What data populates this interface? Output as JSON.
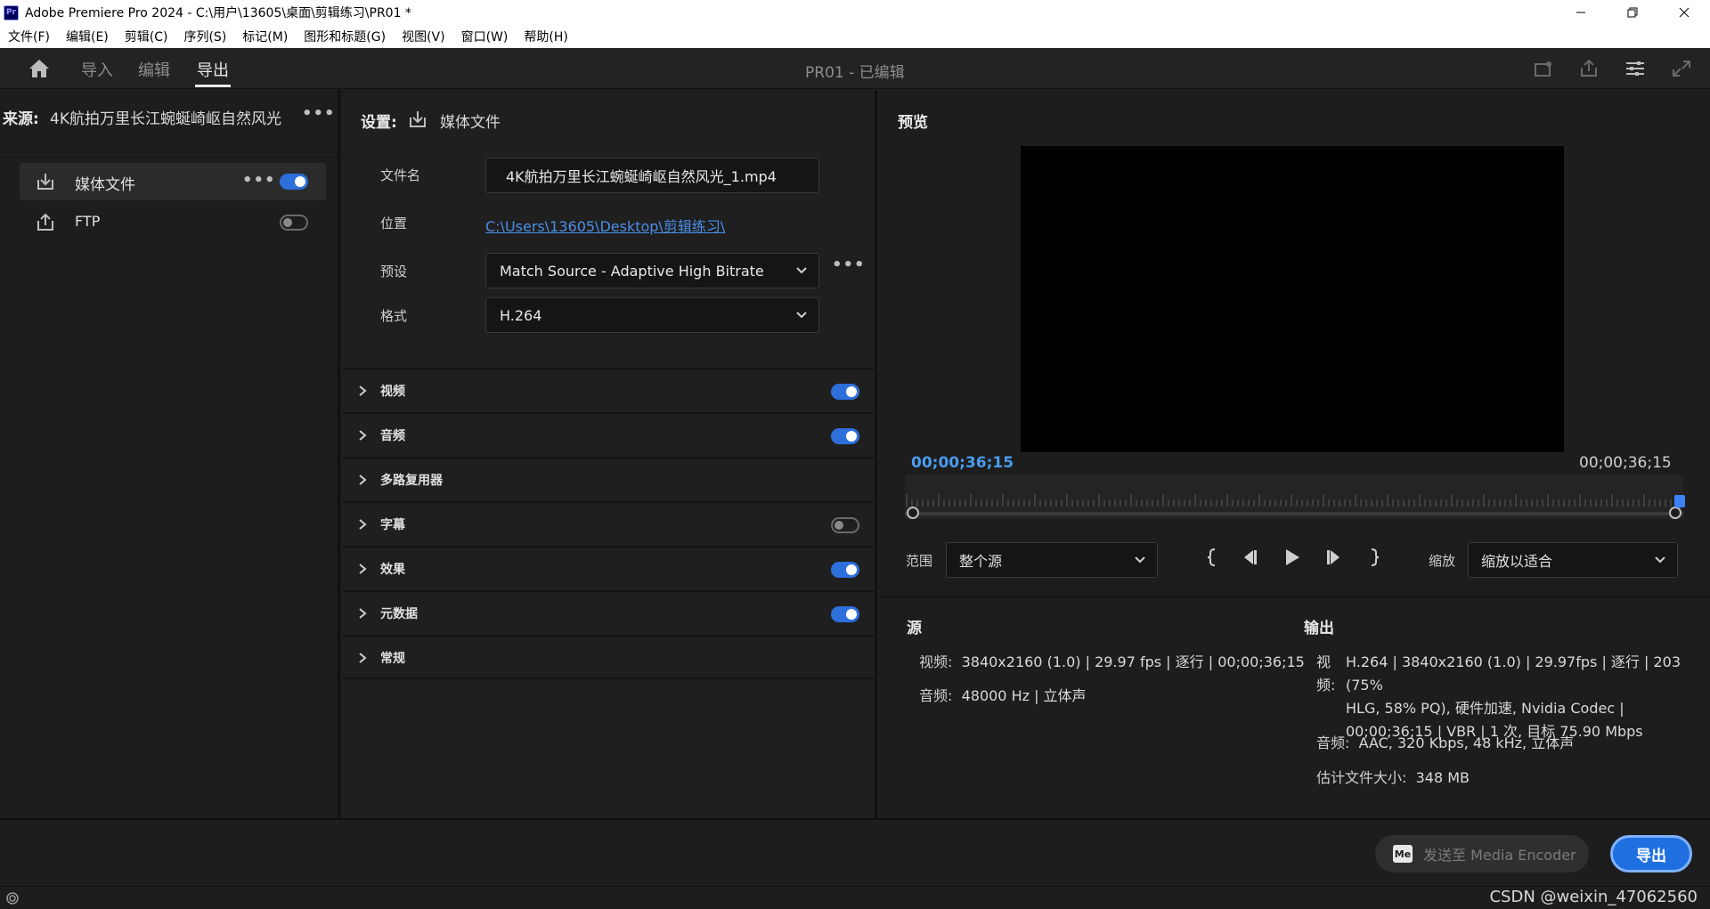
{
  "window": {
    "title": "Adobe Premiere Pro 2024 - C:\\用户\\13605\\桌面\\剪辑练习\\PR01 *",
    "logo_text": "Pr"
  },
  "menu": [
    "文件(F)",
    "编辑(E)",
    "剪辑(C)",
    "序列(S)",
    "标记(M)",
    "图形和标题(G)",
    "视图(V)",
    "窗口(W)",
    "帮助(H)"
  ],
  "header": {
    "tabs": [
      {
        "label": "导入",
        "active": false
      },
      {
        "label": "编辑",
        "active": false
      },
      {
        "label": "导出",
        "active": true
      }
    ],
    "document_title": "PR01 - 已编辑"
  },
  "source_panel": {
    "label": "来源:",
    "name": "4K航拍万里长江蜿蜒崎岖自然风光",
    "more": "•••",
    "destinations": [
      {
        "label": "媒体文件",
        "enabled": true,
        "selected": true,
        "icon": "download-icon"
      },
      {
        "label": "FTP",
        "enabled": false,
        "selected": false,
        "icon": "upload-icon"
      }
    ]
  },
  "settings": {
    "title": "设置:",
    "destination": "媒体文件",
    "filename_label": "文件名",
    "filename_value": "4K航拍万里长江蜿蜒崎岖自然风光_1.mp4",
    "location_label": "位置",
    "location_value": "C:\\Users\\13605\\Desktop\\剪辑练习\\",
    "preset_label": "预设",
    "preset_value": "Match Source - Adaptive High Bitrate",
    "format_label": "格式",
    "format_value": "H.264",
    "sections": [
      {
        "label": "视频",
        "toggle": "on"
      },
      {
        "label": "音频",
        "toggle": "on"
      },
      {
        "label": "多路复用器",
        "toggle": "none"
      },
      {
        "label": "字幕",
        "toggle": "off"
      },
      {
        "label": "效果",
        "toggle": "on"
      },
      {
        "label": "元数据",
        "toggle": "on"
      },
      {
        "label": "常规",
        "toggle": "none"
      }
    ]
  },
  "preview": {
    "title": "预览",
    "tc_in": "00;00;36;15",
    "tc_out": "00;00;36;15",
    "range_label": "范围",
    "range_value": "整个源",
    "zoom_label": "缩放",
    "zoom_value": "缩放以适合"
  },
  "source_info": {
    "title": "源",
    "video_label": "视频:",
    "video_value": "3840x2160 (1.0) | 29.97 fps | 逐行 | 00;00;36;15",
    "audio_label": "音频:",
    "audio_value": "48000 Hz | 立体声"
  },
  "output_info": {
    "title": "输出",
    "video_label_1": "视",
    "video_label_2": "频:",
    "video_line1": "H.264 | 3840x2160 (1.0) | 29.97fps | 逐行 | 203 (75%",
    "video_line2": "HLG, 58% PQ), 硬件加速, Nvidia Codec |",
    "video_line3": "00;00;36;15 | VBR | 1 次, 目标 75.90 Mbps",
    "audio_label": "音频:",
    "audio_value": "AAC, 320 Kbps, 48 kHz, 立体声",
    "size_label": "估计文件大小:",
    "size_value": "348 MB"
  },
  "footer": {
    "me_logo": "Me",
    "send_to_me": "发送至 Media Encoder",
    "export": "导出"
  },
  "watermark": "CSDN @weixin_47062560",
  "colors": {
    "accent": "#2d6fdb",
    "link": "#4a8fe8",
    "timecode": "#4a9cf0"
  }
}
